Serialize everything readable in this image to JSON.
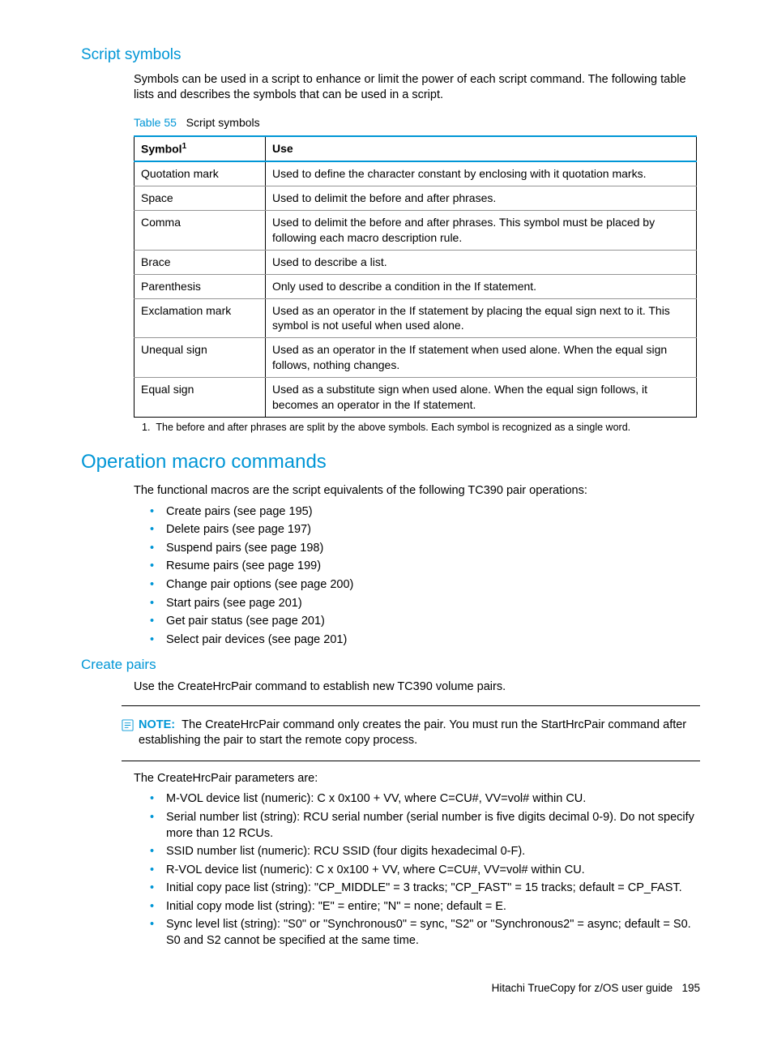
{
  "section1": {
    "heading": "Script symbols",
    "para": "Symbols can be used in a script to enhance or limit the power of each script command. The following table lists and describes the symbols that can be used in a script.",
    "table_label": "Table 55",
    "table_title": "Script symbols",
    "col1": "Symbol",
    "col1_sup": "1",
    "col2": "Use",
    "rows": [
      {
        "sym": "Quotation mark",
        "use": "Used to define the character constant by enclosing with it quotation marks."
      },
      {
        "sym": "Space",
        "use": "Used to delimit the before and after phrases."
      },
      {
        "sym": "Comma",
        "use": "Used to delimit the before and after phrases. This symbol must be placed by following each macro description rule."
      },
      {
        "sym": "Brace",
        "use": "Used to describe a list."
      },
      {
        "sym": "Parenthesis",
        "use": "Only used to describe a condition in the If statement."
      },
      {
        "sym": "Exclamation mark",
        "use": "Used as an operator in the If statement by placing the equal sign next to it. This symbol is not useful when used alone."
      },
      {
        "sym": "Unequal sign",
        "use": "Used as an operator in the If statement when used alone. When the equal sign follows, nothing changes."
      },
      {
        "sym": "Equal sign",
        "use": "Used as a substitute sign when used alone. When the equal sign follows, it becomes an operator in the If statement."
      }
    ],
    "footnote_num": "1.",
    "footnote": "The before and after phrases are split by the above symbols. Each symbol is recognized as a single word."
  },
  "section2": {
    "heading": "Operation macro commands",
    "para": "The functional macros are the script equivalents of the following TC390 pair operations:",
    "items": [
      "Create pairs (see page 195)",
      "Delete pairs (see page 197)",
      "Suspend pairs (see page 198)",
      "Resume pairs (see page 199)",
      "Change pair options (see page 200)",
      "Start pairs (see page 201)",
      "Get pair status (see page 201)",
      "Select pair devices (see page 201)"
    ]
  },
  "section3": {
    "heading": "Create pairs",
    "para": "Use the CreateHrcPair command to establish new TC390 volume pairs.",
    "note_label": "NOTE:",
    "note_text": "The CreateHrcPair command only creates the pair. You must run the StartHrcPair command after establishing the pair to start the remote copy process.",
    "para2": "The CreateHrcPair parameters are:",
    "params": [
      "M-VOL device list (numeric): C x 0x100 + VV, where C=CU#, VV=vol# within CU.",
      "Serial number list (string): RCU serial number (serial number is five digits decimal 0-9). Do not specify more than 12 RCUs.",
      "SSID number list (numeric): RCU SSID (four digits hexadecimal 0-F).",
      "R-VOL device list (numeric): C x 0x100 + VV, where C=CU#, VV=vol# within CU.",
      "Initial copy pace list (string): \"CP_MIDDLE\" = 3 tracks; \"CP_FAST\" = 15 tracks; default = CP_FAST.",
      "Initial copy mode list (string): \"E\" = entire; \"N\" = none; default = E.",
      "Sync level list (string): \"S0\" or \"Synchronous0\" = sync, \"S2\" or \"Synchronous2\" = async; default = S0. S0 and S2 cannot be specified at the same time."
    ]
  },
  "footer": {
    "title": "Hitachi TrueCopy for z/OS user guide",
    "page": "195"
  }
}
